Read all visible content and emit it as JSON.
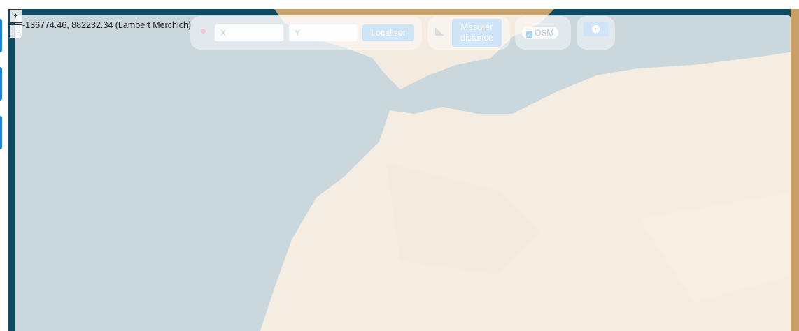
{
  "map": {
    "coordinate_readout": "-136774.46, 882232.34 (Lambert Merchich)"
  },
  "zoom": {
    "zoom_in_label": "+",
    "zoom_out_label": "−"
  },
  "locate": {
    "x_placeholder": "X",
    "y_placeholder": "Y",
    "button_label": "Localiser"
  },
  "measure": {
    "button_label_line1": "Mesurer",
    "button_label_line2": "distance"
  },
  "layers": {
    "osm_label": "OSM",
    "osm_checked": true
  },
  "info": {
    "icon": "info-icon"
  },
  "colors": {
    "accent": "#1e7fd6",
    "sea": "#0f4a63",
    "land": "#c9a46e"
  }
}
